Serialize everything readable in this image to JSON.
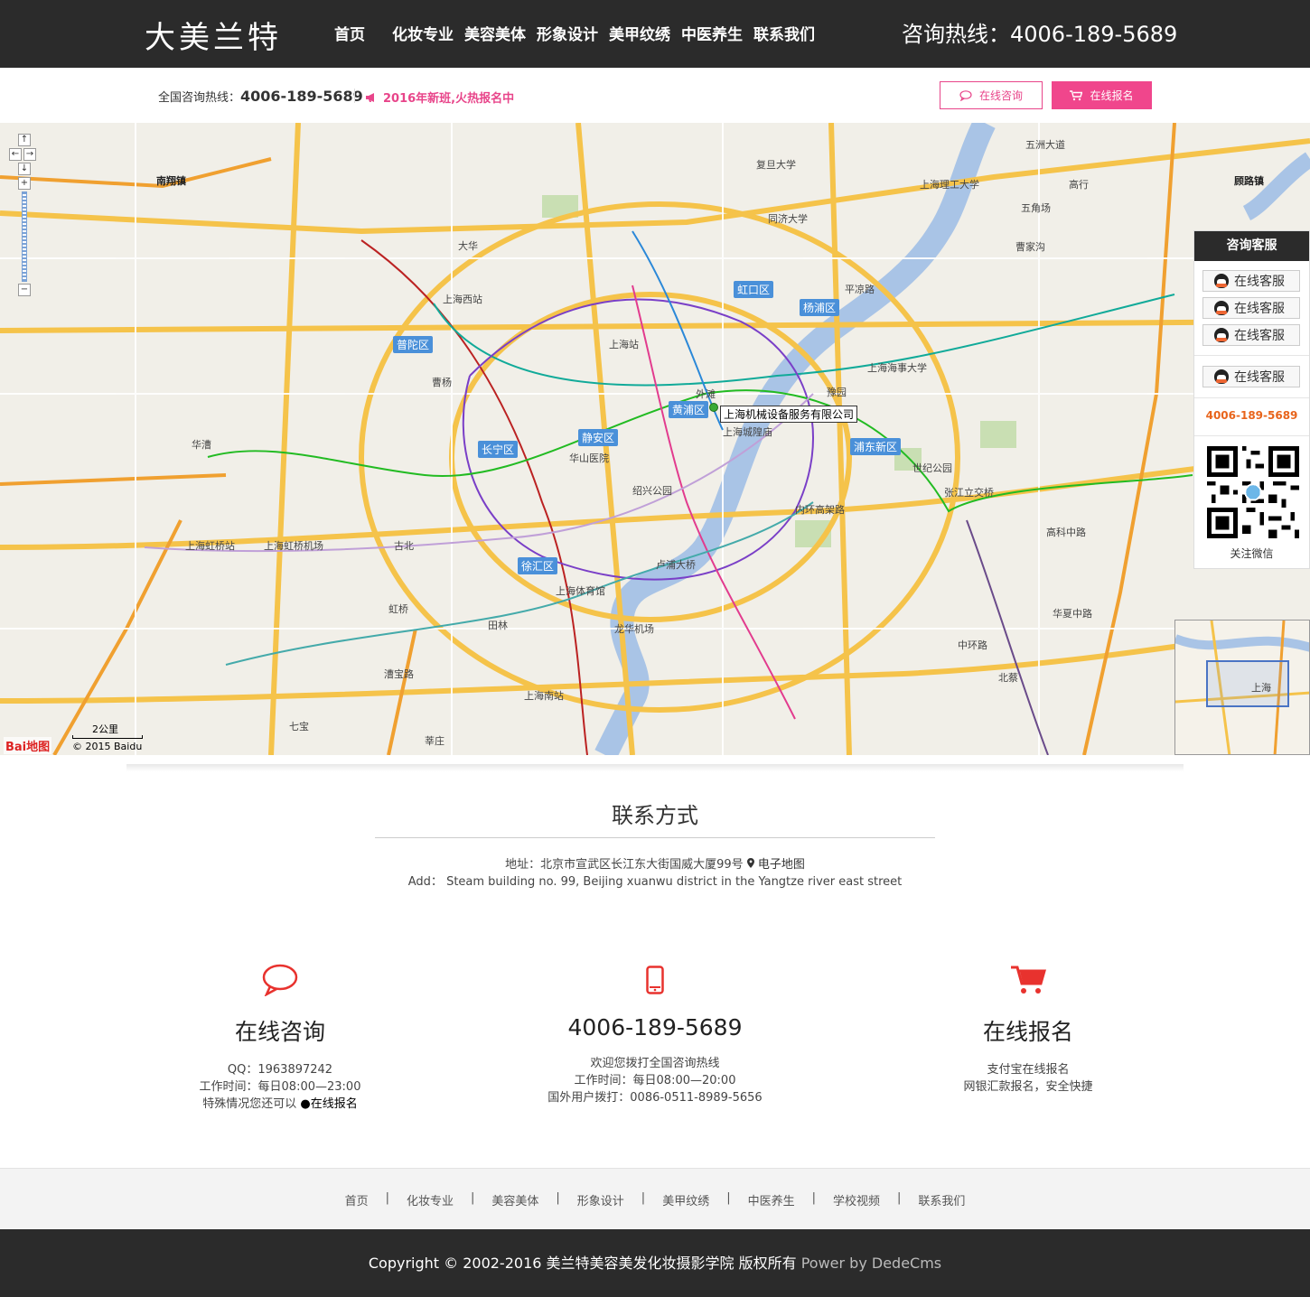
{
  "header": {
    "logo": "大美兰特",
    "nav": [
      "首页",
      "化妆专业",
      "美容美体",
      "形象设计",
      "美甲纹绣",
      "中医养生",
      "联系我们"
    ],
    "hotline": "咨询热线：4006-189-5689"
  },
  "subbar": {
    "hotline_label": "全国咨询热线：",
    "hotline_number": "4006-189-5689",
    "news": "2016年新班,火热报名中",
    "consult_button": "在线咨询",
    "enroll_button": "在线报名"
  },
  "map": {
    "marker_label": "上海机械设备服务有限公司",
    "scale": "2公里",
    "logo": "Bai地图",
    "copyright": "© 2015 Baidu",
    "districts": [
      "虹口区",
      "杨浦区",
      "普陀区",
      "黄浦区",
      "静安区",
      "长宁区",
      "浦东新区",
      "徐汇区"
    ],
    "places": [
      "南翔镇",
      "大华",
      "上海西站",
      "上海站",
      "外滩",
      "豫园",
      "上海城隍庙",
      "华山医院",
      "绍兴公园",
      "卢浦大桥",
      "上海体育馆",
      "龙华机场",
      "上海南站",
      "华漕",
      "上海虹桥站",
      "上海虹桥机场",
      "古北",
      "虹桥",
      "田林",
      "曹杨",
      "平凉路",
      "五角场",
      "上海理工大学",
      "复旦大学",
      "同济大学",
      "张江立交桥",
      "世纪公园",
      "高行",
      "顾路镇",
      "曹家沟",
      "五洲大道",
      "内环高架路",
      "中环路",
      "北蔡",
      "漕宝路",
      "七宝",
      "莘庄",
      "高科中路",
      "华夏中路",
      "上海海事大学"
    ],
    "overview_label": "上海"
  },
  "service_panel": {
    "title": "咨询客服",
    "buttons": [
      "在线客服",
      "在线客服",
      "在线客服",
      "在线客服"
    ],
    "phone": "4006-189-5689",
    "qr_label": "关注微信"
  },
  "contact": {
    "title": "联系方式",
    "address": "地址：北京市宣武区长江东大街国威大厦99号",
    "map_link": "电子地图",
    "address_en": "Add：  Steam building no. 99, Beijing xuanwu district in the Yangtze river east street"
  },
  "columns": [
    {
      "icon": "chat-bubble-icon",
      "title": "在线咨询",
      "lines": [
        "QQ：1963897242",
        "工作时间：每日08:00—23:00"
      ],
      "special_text": "特殊情况您还可以 ",
      "special_link": "●在线报名"
    },
    {
      "icon": "mobile-phone-icon",
      "title": "4006-189-5689",
      "lines": [
        "欢迎您拨打全国咨询热线",
        "工作时间：每日08:00—20:00",
        "国外用户拨打：0086-0511-8989-5656"
      ]
    },
    {
      "icon": "shopping-cart-icon",
      "title": "在线报名",
      "lines": [
        "支付宝在线报名",
        "网银汇款报名，安全快捷"
      ]
    }
  ],
  "footer": {
    "links": [
      "首页",
      "化妆专业",
      "美容美体",
      "形象设计",
      "美甲纹绣",
      "中医养生",
      "学校视频",
      "联系我们"
    ],
    "separator": "|",
    "copyright": "Copyright © 2002-2016 美兰特美容美发化妆摄影学院 版权所有",
    "power": "Power by DedeCms"
  },
  "colors": {
    "dark_bar": "#2b2b2b",
    "accent_pink": "#f0468c",
    "accent_red": "#e8322e",
    "phone_orange": "#e8641b"
  }
}
